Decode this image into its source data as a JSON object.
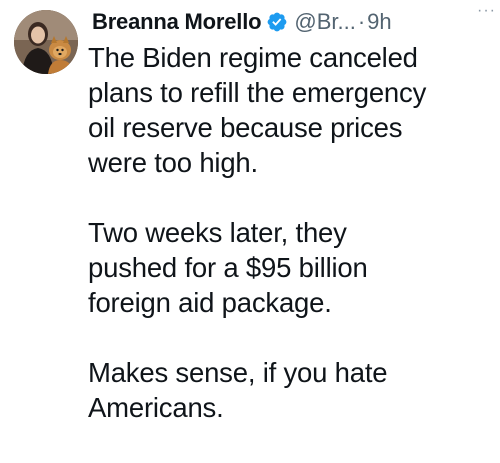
{
  "tweet": {
    "author": {
      "display_name": "Breanna Morello",
      "handle": "@Br...",
      "verified": true,
      "verified_color": "#1d9bf0"
    },
    "separator": "·",
    "timestamp": "9h",
    "more_label": "···",
    "text_lines": {
      "p1": [
        "The Biden regime canceled",
        "plans to refill the emergency",
        "oil reserve because prices",
        "were too high."
      ],
      "p2": [
        "Two weeks later, they",
        "pushed for a $95 billion",
        "foreign aid package."
      ],
      "p3": [
        "Makes sense, if you hate",
        "Americans."
      ]
    }
  }
}
